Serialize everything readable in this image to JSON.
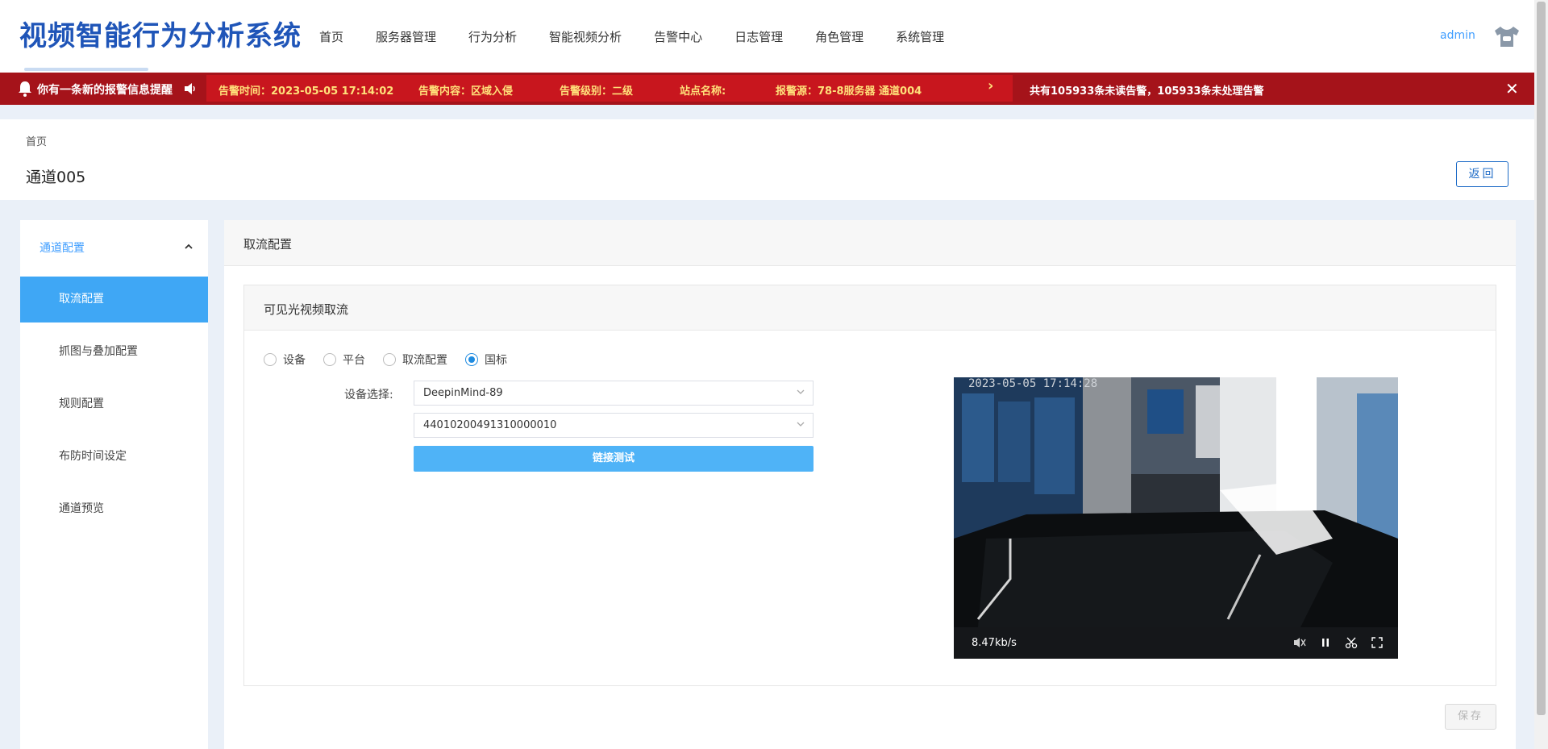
{
  "header": {
    "logo": "视频智能行为分析系统",
    "nav": [
      "首页",
      "服务器管理",
      "行为分析",
      "智能视频分析",
      "告警中心",
      "日志管理",
      "角色管理",
      "系统管理"
    ],
    "user": "admin"
  },
  "alarm": {
    "notice": "你有一条新的报警信息提醒",
    "time": "告警时间：2023-05-05 17:14:02",
    "content": "告警内容：区域入侵",
    "level": "告警级别：二级",
    "site": "站点名称:",
    "source": "报警源：78-8服务器 通道004",
    "summary": "共有105933条未读告警，105933条未处理告警",
    "colors": {
      "bar": "#a5131a",
      "panel": "#c8161e",
      "highlight": "#ffe07a"
    }
  },
  "page": {
    "breadcrumb": "首页",
    "title": "通道005",
    "back_label": "返回"
  },
  "sidebar": {
    "group_label": "通道配置",
    "items": [
      "取流配置",
      "抓图与叠加配置",
      "规则配置",
      "布防时间设定",
      "通道预览"
    ],
    "active_index": 0
  },
  "main": {
    "section_title": "取流配置",
    "card_title": "可见光视频取流",
    "radios": [
      "设备",
      "平台",
      "取流配置",
      "国标"
    ],
    "radio_selected": "国标",
    "device_label": "设备选择:",
    "device_value": "DeepinMind-89",
    "channel_value": "44010200491310000010",
    "test_label": "链接测试",
    "save_label": "保存"
  },
  "video": {
    "timestamp": "2023-05-05 17:14:28",
    "rate": "8.47kb/s"
  }
}
